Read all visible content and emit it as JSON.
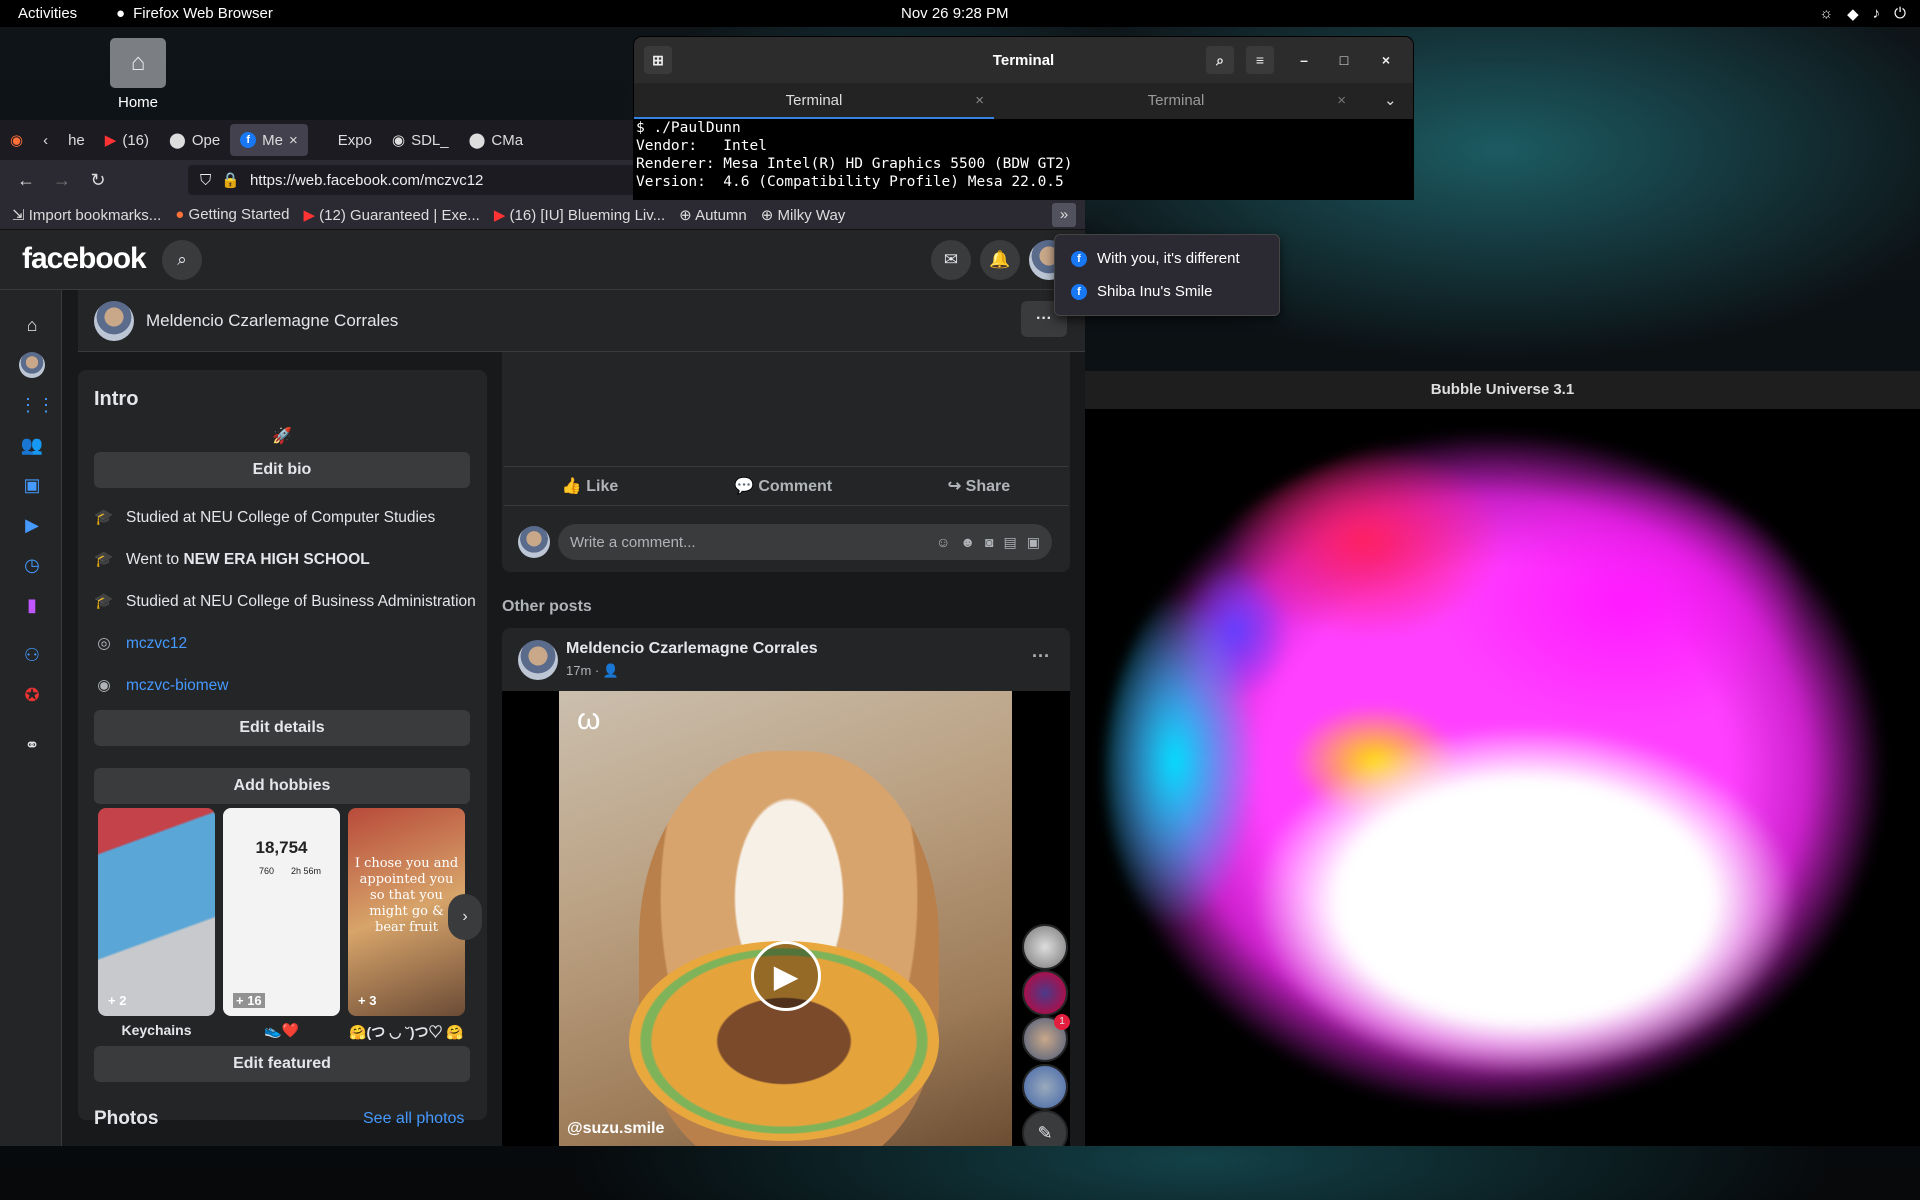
{
  "topbar": {
    "activities": "Activities",
    "app": "Firefox Web Browser",
    "clock": "Nov 26  9:28 PM"
  },
  "desktop": {
    "home_label": "Home"
  },
  "browser": {
    "tabs": [
      {
        "label": "he"
      },
      {
        "label": "(16)"
      },
      {
        "label": "Ope"
      },
      {
        "label": "Me"
      },
      {
        "label": "Expo"
      },
      {
        "label": "SDL_"
      },
      {
        "label": "CMa"
      }
    ],
    "url": "https://web.facebook.com/mczvc12",
    "bookmarks": [
      "Import bookmarks...",
      "Getting Started",
      "(12) Guaranteed | Exe...",
      "(16) [IU] Blueming Liv...",
      "Autumn",
      "Milky Way"
    ]
  },
  "dropdown": {
    "items": [
      "With you, it's different",
      "Shiba Inu's Smile"
    ]
  },
  "facebook": {
    "logo": "facebook",
    "profile_name": "Meldencio Czarlemagne Corrales",
    "intro": {
      "title": "Intro",
      "bio_emoji": "🚀",
      "edit_bio": "Edit bio",
      "items": [
        {
          "pre": "Studied at NEU College of Computer Studies",
          "bold": ""
        },
        {
          "pre": "Went to ",
          "bold": "NEW ERA HIGH SCHOOL"
        },
        {
          "pre": "Studied at NEU College of Business Administration",
          "bold": ""
        }
      ],
      "instagram": "mczvc12",
      "github": "mczvc-biomew",
      "edit_details": "Edit details",
      "add_hobbies": "Add hobbies",
      "featured": [
        {
          "caption": "Keychains",
          "count": "+ 2"
        },
        {
          "caption": "👟❤️",
          "count": "+ 16",
          "steps": "18,754",
          "sub1": "760",
          "sub2": "2h 56m"
        },
        {
          "caption": "🤗(つ ◡ ˘)つ♡ 🤗",
          "count": "+ 3",
          "quote": "I chose you and appointed you so that you might go & bear fruit"
        }
      ],
      "edit_featured": "Edit featured",
      "photos": "Photos",
      "see_all": "See all photos"
    },
    "actions": {
      "like": "Like",
      "comment": "Comment",
      "share": "Share"
    },
    "comment_placeholder": "Write a comment...",
    "other_posts": "Other posts",
    "post": {
      "author": "Meldencio Czarlemagne Corrales",
      "time": "17m ·",
      "video_caption": "@suzu.smile",
      "story_badge": "1"
    }
  },
  "terminal": {
    "title": "Terminal",
    "tabs": [
      "Terminal",
      "Terminal"
    ],
    "lines": [
      "$ ./PaulDunn",
      "Vendor:   Intel",
      "Renderer: Mesa Intel(R) HD Graphics 5500 (BDW GT2)",
      "Version:  4.6 (Compatibility Profile) Mesa 22.0.5"
    ]
  },
  "bubble": {
    "title": "Bubble Universe 3.1"
  }
}
